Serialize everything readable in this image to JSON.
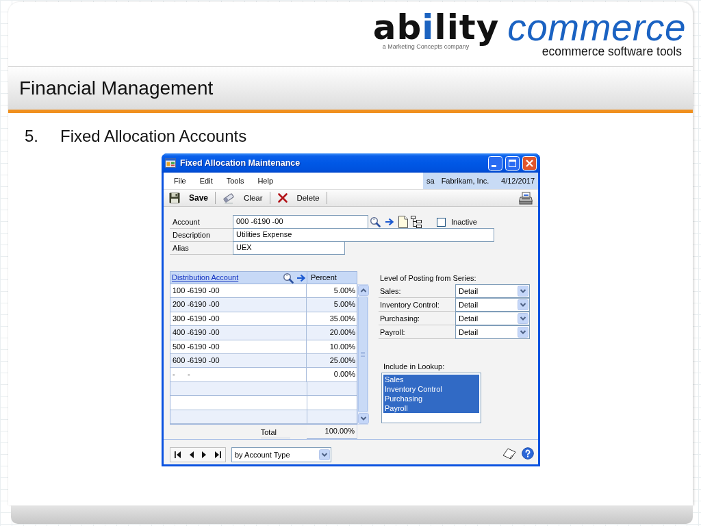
{
  "logo": {
    "wordmark": [
      {
        "text": "ab",
        "accent": false
      },
      {
        "text": "i",
        "accent": true
      },
      {
        "text": "lity",
        "accent": false
      }
    ],
    "tagline": "a Marketing Concepts company",
    "product": "commerce",
    "subtitle": "ecommerce software tools"
  },
  "slide": {
    "title": "Financial Management",
    "step_number": "5.",
    "step_title": "Fixed Allocation Accounts"
  },
  "window": {
    "title": "Fixed Allocation Maintenance",
    "menu": [
      "File",
      "Edit",
      "Tools",
      "Help"
    ],
    "session": {
      "user": "sa",
      "company": "Fabrikam, Inc.",
      "date": "4/12/2017"
    },
    "toolbar": [
      {
        "kind": "save",
        "label": "Save"
      },
      {
        "kind": "clear",
        "label": "Clear"
      },
      {
        "kind": "delete",
        "label": "Delete"
      },
      {
        "kind": "print"
      }
    ],
    "fields": [
      {
        "kind": "account",
        "label": "Account",
        "value": "000 -6190 -00"
      },
      {
        "kind": "description",
        "label": "Description",
        "value": "Utilities Expense"
      },
      {
        "kind": "alias",
        "label": "Alias",
        "value": "UEX"
      }
    ],
    "inactive": {
      "label": "Inactive",
      "checked": false
    },
    "distribution": {
      "columns": [
        "Distribution Account",
        "Percent"
      ],
      "rows": [
        {
          "account": "100 -6190 -00",
          "percent": "5.00%"
        },
        {
          "account": "200 -6190 -00",
          "percent": "5.00%"
        },
        {
          "account": "300 -6190 -00",
          "percent": "35.00%"
        },
        {
          "account": "400 -6190 -00",
          "percent": "20.00%"
        },
        {
          "account": "500 -6190 -00",
          "percent": "10.00%"
        },
        {
          "account": "600 -6190 -00",
          "percent": "25.00%"
        },
        {
          "account": "-      -",
          "percent": "0.00%"
        }
      ],
      "total": {
        "label": "Total",
        "value": "100.00%"
      }
    },
    "posting": {
      "title": "Level of Posting from Series:",
      "series": [
        {
          "label": "Sales:",
          "value": "Detail"
        },
        {
          "label": "Inventory Control:",
          "value": "Detail"
        },
        {
          "label": "Purchasing:",
          "value": "Detail"
        },
        {
          "label": "Payroll:",
          "value": "Detail"
        }
      ]
    },
    "lookup": {
      "title": "Include in Lookup:",
      "items": [
        {
          "label": "Sales",
          "selected": true
        },
        {
          "label": "Inventory Control",
          "selected": true
        },
        {
          "label": "Purchasing",
          "selected": true
        },
        {
          "label": "Payroll",
          "selected": true
        }
      ]
    },
    "footer": {
      "sort": "by Account Type"
    }
  }
}
